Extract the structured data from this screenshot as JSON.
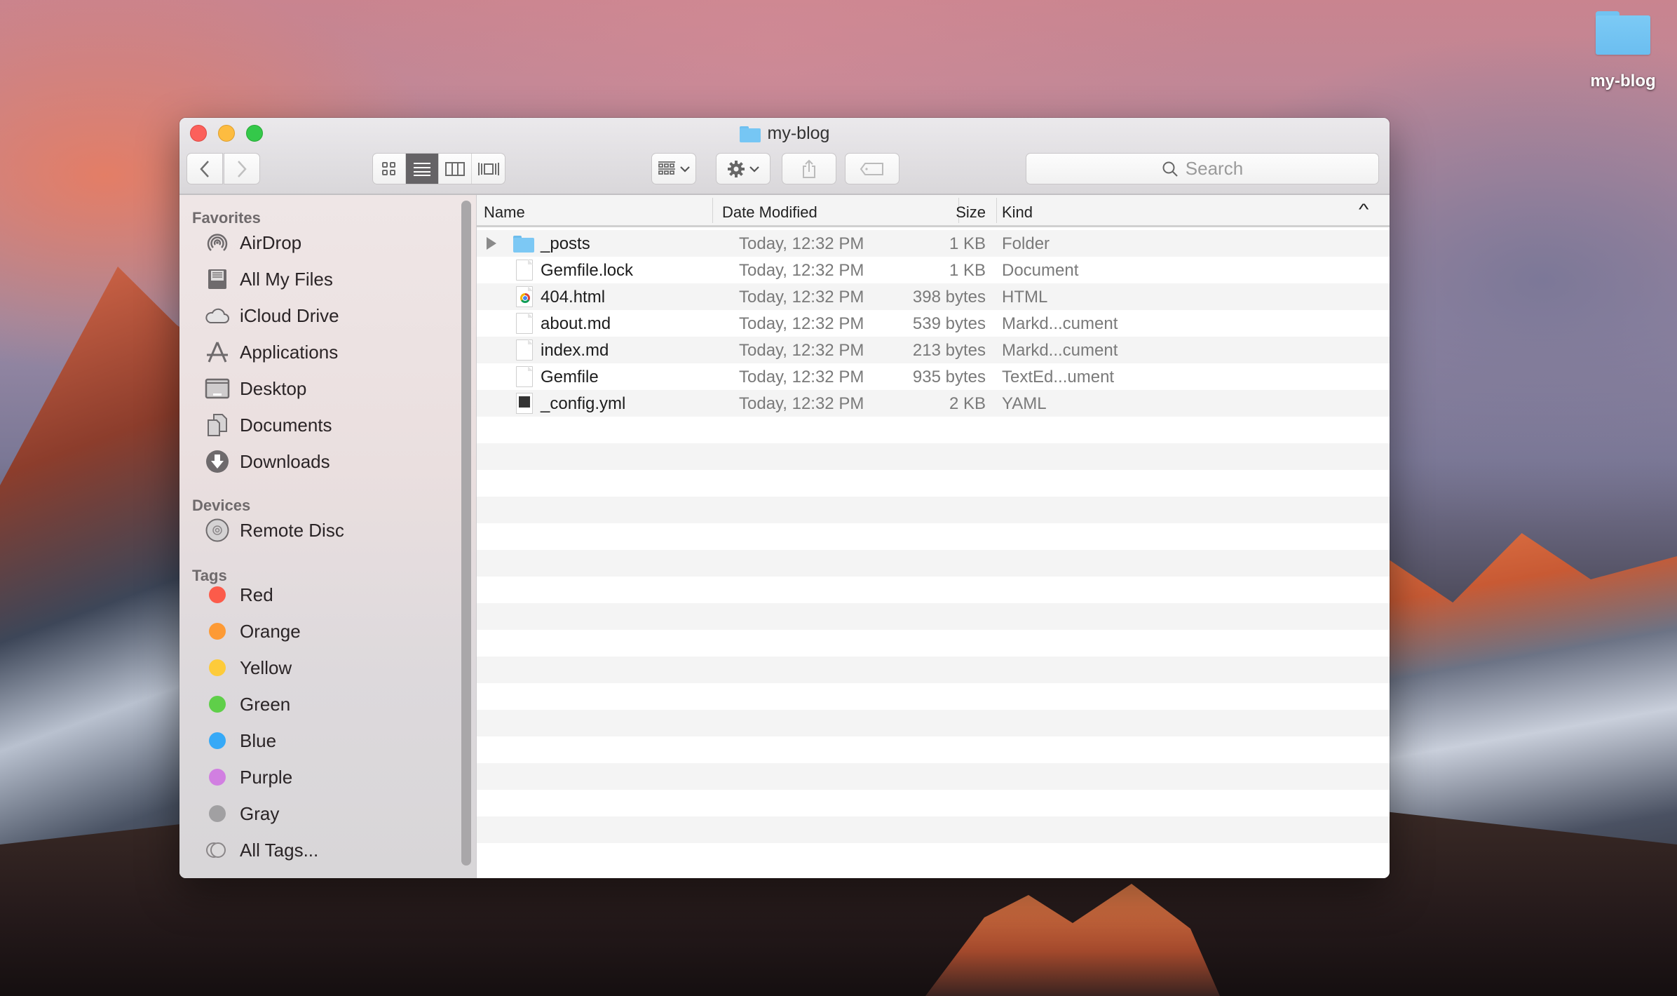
{
  "desktop": {
    "icons": [
      {
        "label": "my-blog",
        "icon": "folder-icon"
      }
    ]
  },
  "window": {
    "title": "my-blog",
    "title_icon": "folder-icon",
    "toolbar": {
      "back_icon": "chevron-left-icon",
      "forward_icon": "chevron-right-icon",
      "view_modes": [
        {
          "name": "icon-view",
          "icon": "grid-icon",
          "active": false
        },
        {
          "name": "list-view",
          "icon": "list-icon",
          "active": true
        },
        {
          "name": "column-view",
          "icon": "columns-icon",
          "active": false
        },
        {
          "name": "cover-flow-view",
          "icon": "coverflow-icon",
          "active": false
        }
      ],
      "arrange_icon": "arrange-icon",
      "action_icon": "gear-icon",
      "share_icon": "share-icon",
      "tag_icon": "tag-icon",
      "search_placeholder": "Search"
    },
    "sidebar": {
      "favorites": {
        "heading": "Favorites",
        "items": [
          {
            "label": "AirDrop",
            "icon": "airdrop-icon"
          },
          {
            "label": "All My Files",
            "icon": "all-files-icon"
          },
          {
            "label": "iCloud Drive",
            "icon": "cloud-icon"
          },
          {
            "label": "Applications",
            "icon": "applications-icon"
          },
          {
            "label": "Desktop",
            "icon": "desktop-icon"
          },
          {
            "label": "Documents",
            "icon": "documents-icon"
          },
          {
            "label": "Downloads",
            "icon": "downloads-icon"
          }
        ]
      },
      "devices": {
        "heading": "Devices",
        "items": [
          {
            "label": "Remote Disc",
            "icon": "disc-icon"
          }
        ]
      },
      "tags": {
        "heading": "Tags",
        "items": [
          {
            "label": "Red",
            "color": "#fc5b4a"
          },
          {
            "label": "Orange",
            "color": "#fd9a35"
          },
          {
            "label": "Yellow",
            "color": "#fdcb3a"
          },
          {
            "label": "Green",
            "color": "#5fcf49"
          },
          {
            "label": "Blue",
            "color": "#36a9f7"
          },
          {
            "label": "Purple",
            "color": "#d17fe1"
          },
          {
            "label": "Gray",
            "color": "#a1a0a2"
          },
          {
            "label": "All Tags...",
            "color": ""
          }
        ]
      }
    },
    "list": {
      "columns": {
        "name": "Name",
        "date": "Date Modified",
        "size": "Size",
        "kind": "Kind"
      },
      "sort_indicator": "^",
      "rows": [
        {
          "name": "_posts",
          "date": "Today, 12:32 PM",
          "size": "1 KB",
          "kind": "Folder",
          "type": "folder"
        },
        {
          "name": "Gemfile.lock",
          "date": "Today, 12:32 PM",
          "size": "1 KB",
          "kind": "Document",
          "type": "doc"
        },
        {
          "name": "404.html",
          "date": "Today, 12:32 PM",
          "size": "398 bytes",
          "kind": "HTML",
          "type": "html"
        },
        {
          "name": "about.md",
          "date": "Today, 12:32 PM",
          "size": "539 bytes",
          "kind": "Markd...cument",
          "type": "doc"
        },
        {
          "name": "index.md",
          "date": "Today, 12:32 PM",
          "size": "213 bytes",
          "kind": "Markd...cument",
          "type": "doc"
        },
        {
          "name": "Gemfile",
          "date": "Today, 12:32 PM",
          "size": "935 bytes",
          "kind": "TextEd...ument",
          "type": "doc"
        },
        {
          "name": "_config.yml",
          "date": "Today, 12:32 PM",
          "size": "2 KB",
          "kind": "YAML",
          "type": "yaml"
        }
      ]
    }
  }
}
